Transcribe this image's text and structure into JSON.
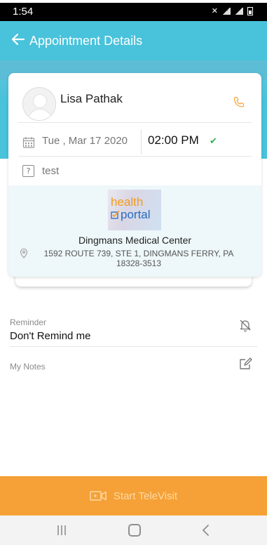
{
  "status_bar": {
    "time": "1:54"
  },
  "app_bar": {
    "title": "Appointment Details"
  },
  "appointment": {
    "doctor_name": "Lisa Pathak",
    "date": "Tue , Mar 17 2020",
    "time": "02:00 PM",
    "reason": "test"
  },
  "facility": {
    "logo_health": "health",
    "logo_portal": "portal",
    "name": "Dingmans Medical Center",
    "address": "1592 ROUTE 739, STE 1, DINGMANS FERRY, PA 18328-3513"
  },
  "reminder": {
    "label": "Reminder",
    "value": "Don't Remind me"
  },
  "notes": {
    "label": "My Notes"
  },
  "televisit": {
    "label": "Start TeleVisit"
  },
  "colors": {
    "primary": "#49c2db",
    "accent": "#f5a137",
    "confirmed": "#2bb24c"
  },
  "icons": [
    "back-arrow-icon",
    "phone-icon",
    "calendar-icon",
    "check-icon",
    "question-icon",
    "location-pin-icon",
    "bell-off-icon",
    "edit-icon",
    "video-camera-icon"
  ]
}
